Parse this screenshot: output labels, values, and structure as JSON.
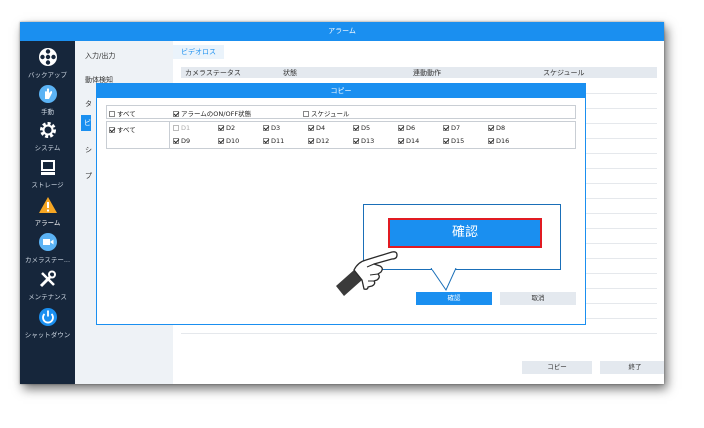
{
  "window": {
    "title": "アラーム"
  },
  "sidebar": {
    "items": [
      {
        "label": "バックアップ",
        "icon": "film-reel-icon"
      },
      {
        "label": "手動",
        "icon": "hand-icon"
      },
      {
        "label": "システム",
        "icon": "gear-icon"
      },
      {
        "label": "ストレージ",
        "icon": "storage-icon"
      },
      {
        "label": "アラーム",
        "icon": "warning-icon"
      },
      {
        "label": "カメラステー...",
        "icon": "camera-icon"
      },
      {
        "label": "メンテナンス",
        "icon": "tools-icon"
      },
      {
        "label": "シャットダウン",
        "icon": "power-icon"
      }
    ]
  },
  "menu": {
    "items": [
      "入力/出力",
      "動体検知",
      "タ",
      "ビ",
      "シ",
      "プ"
    ]
  },
  "content": {
    "tab": "ビデオロス",
    "columns": [
      "カメラステータス",
      "状態",
      "連動動作",
      "スケジュール"
    ],
    "copy_button": "コピー",
    "exit_button": "終了"
  },
  "dialog": {
    "title": "コピー",
    "row1": {
      "all": "すべて",
      "alarm_onoff": "アラームのON/OFF状態",
      "schedule": "スケジュール"
    },
    "row2_all": "すべて",
    "channels": [
      "D1",
      "D2",
      "D3",
      "D4",
      "D5",
      "D6",
      "D7",
      "D8",
      "D9",
      "D10",
      "D11",
      "D12",
      "D13",
      "D14",
      "D15",
      "D16"
    ],
    "confirm_button": "確認",
    "cancel_button": "取消"
  },
  "callout": {
    "label": "確認"
  },
  "colors": {
    "accent": "#1a8ff0",
    "sidebar": "#16263b",
    "highlight": "#e11b22"
  }
}
